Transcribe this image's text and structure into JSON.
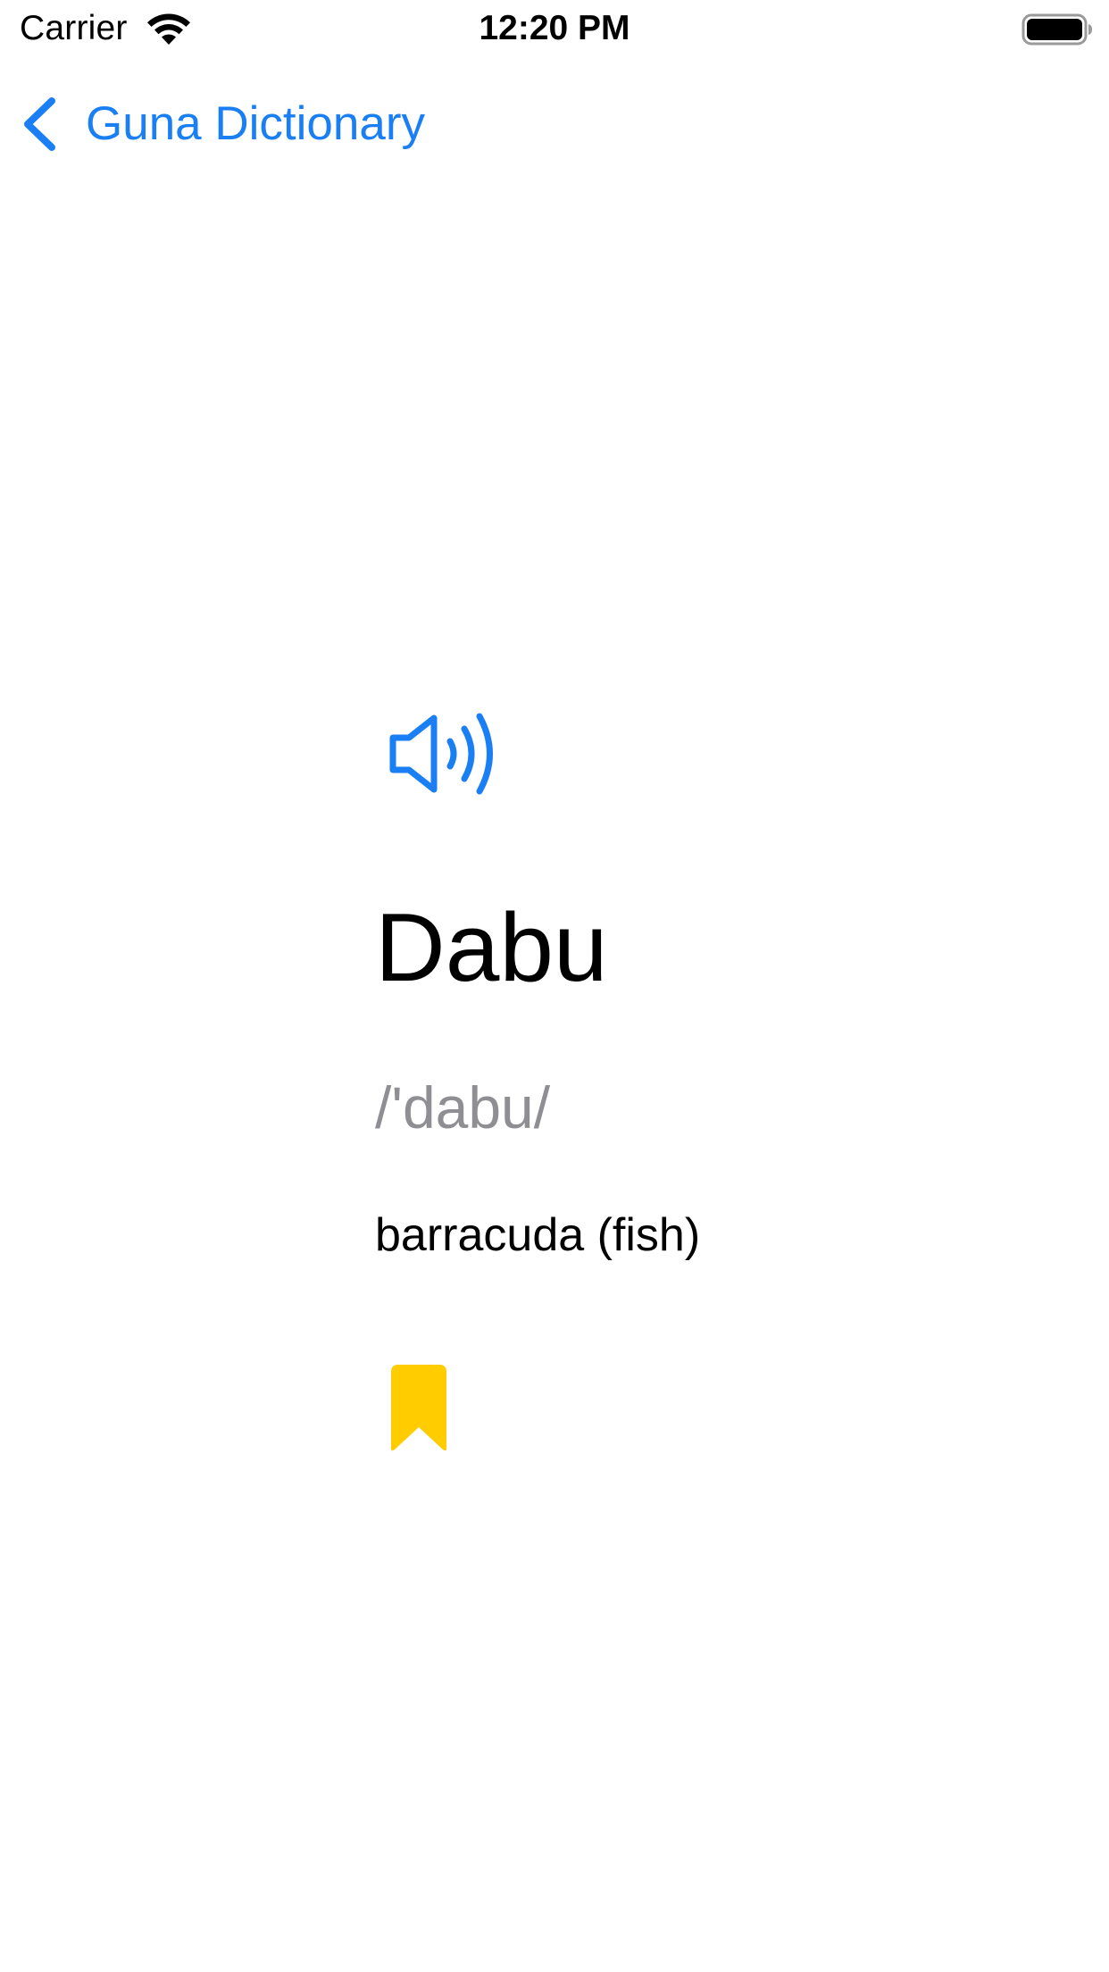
{
  "status_bar": {
    "carrier": "Carrier",
    "time": "12:20 PM",
    "wifi_icon": "wifi-icon",
    "battery_icon": "battery-full-icon"
  },
  "nav": {
    "back_label": "Guna Dictionary",
    "back_icon": "chevron-left-icon"
  },
  "entry": {
    "word": "Dabu",
    "phonetic": "/'dabu/",
    "definition": "barracuda (fish)",
    "speaker_icon": "speaker-wave-icon",
    "bookmark_icon": "bookmark-filled-icon",
    "bookmarked": true
  },
  "colors": {
    "accent": "#1a7ff5",
    "bookmark": "#ffcc00",
    "phonetic": "#8e8e93",
    "text": "#000000",
    "background": "#ffffff"
  }
}
